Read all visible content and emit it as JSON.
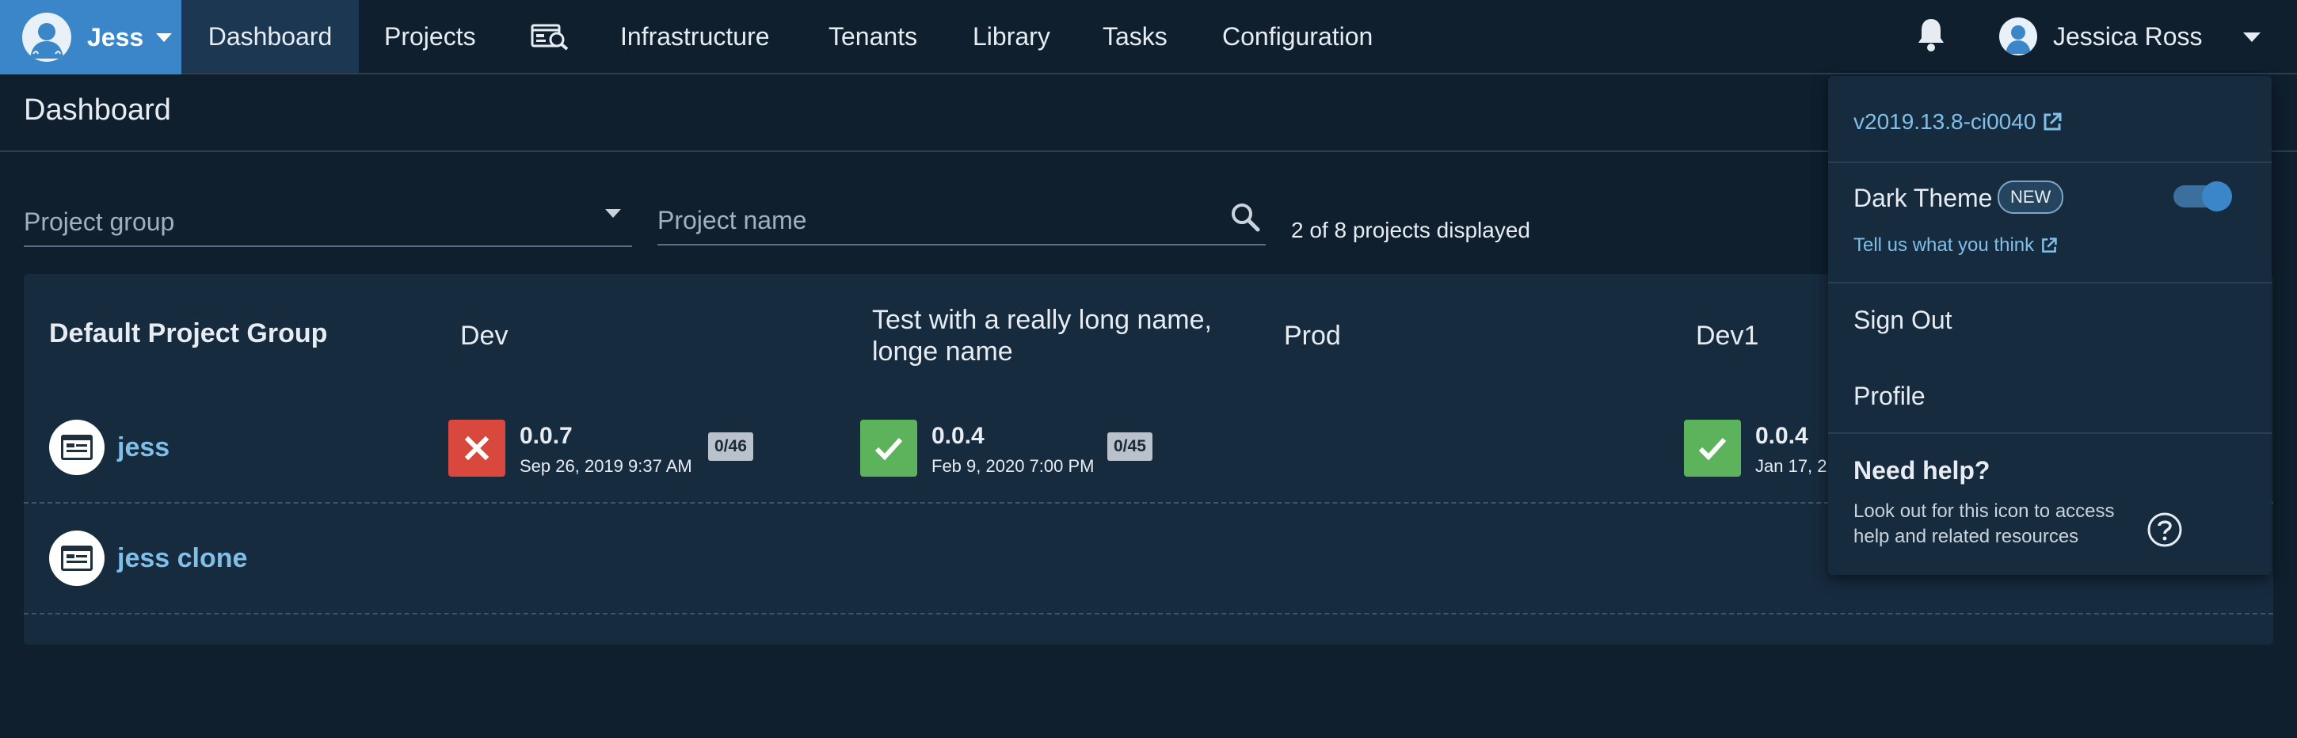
{
  "nav": {
    "space_name": "Jess",
    "items": [
      "Dashboard",
      "Projects",
      "Infrastructure",
      "Tenants",
      "Library",
      "Tasks",
      "Configuration"
    ],
    "active": "Dashboard",
    "user_name": "Jessica Ross",
    "icons": [
      "space-avatar-icon",
      "search-dashboard-icon",
      "bell-icon",
      "user-avatar-icon"
    ]
  },
  "page": {
    "title": "Dashboard"
  },
  "filters": {
    "project_group_placeholder": "Project group",
    "project_name_placeholder": "Project name",
    "count_text": "2 of 8 projects displayed"
  },
  "group": {
    "name": "Default Project Group",
    "environments": [
      "Dev",
      "Test with a really long name, longe name",
      "Prod",
      "Dev1"
    ],
    "projects": [
      {
        "name": "jess",
        "deployments": [
          {
            "env": "Dev",
            "status": "failed",
            "version": "0.0.7",
            "date": "Sep 26, 2019 9:37 AM",
            "tasks": "0/46"
          },
          {
            "env": "Test with a really long name, longe name",
            "status": "success",
            "version": "0.0.4",
            "date": "Feb 9, 2020 7:00 PM",
            "tasks": "0/45"
          },
          {
            "env": "Dev1",
            "status": "success",
            "version": "0.0.4",
            "date": "Jan 17, 2"
          }
        ]
      },
      {
        "name": "jess clone",
        "deployments": []
      }
    ]
  },
  "menu": {
    "version": "v2019.13.8-ci0040",
    "dark_theme_label": "Dark Theme",
    "new_badge": "NEW",
    "dark_theme_enabled": true,
    "feedback_link": "Tell us what you think",
    "sign_out": "Sign Out",
    "profile": "Profile",
    "help_title": "Need help?",
    "help_text": "Look out for this icon to access help and related resources"
  },
  "colors": {
    "background": "#0f1f2e",
    "accent": "#3a86c8",
    "link": "#7fbfe8",
    "failed": "#d9483c",
    "success": "#5db35b"
  }
}
